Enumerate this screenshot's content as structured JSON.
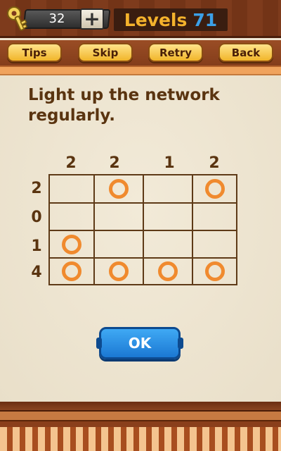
{
  "header": {
    "key_count": "32",
    "level_label": "Levels",
    "level_number": "71"
  },
  "toolbar": {
    "tips": "Tips",
    "skip": "Skip",
    "retry": "Retry",
    "back": "Back"
  },
  "puzzle": {
    "instruction": "Light up the network regularly.",
    "column_hints": [
      "2",
      "2",
      "1",
      "2"
    ],
    "row_hints": [
      "2",
      "0",
      "1",
      "4"
    ],
    "lamps": [
      [
        false,
        true,
        false,
        true
      ],
      [
        false,
        false,
        false,
        false
      ],
      [
        true,
        false,
        false,
        false
      ],
      [
        true,
        true,
        true,
        true
      ]
    ]
  },
  "ok_label": "OK",
  "colors": {
    "lamp": "#f08a2e",
    "button_yellow": "#f1b52a",
    "ok_blue": "#1b78d3",
    "wood": "#7e3b1c"
  }
}
